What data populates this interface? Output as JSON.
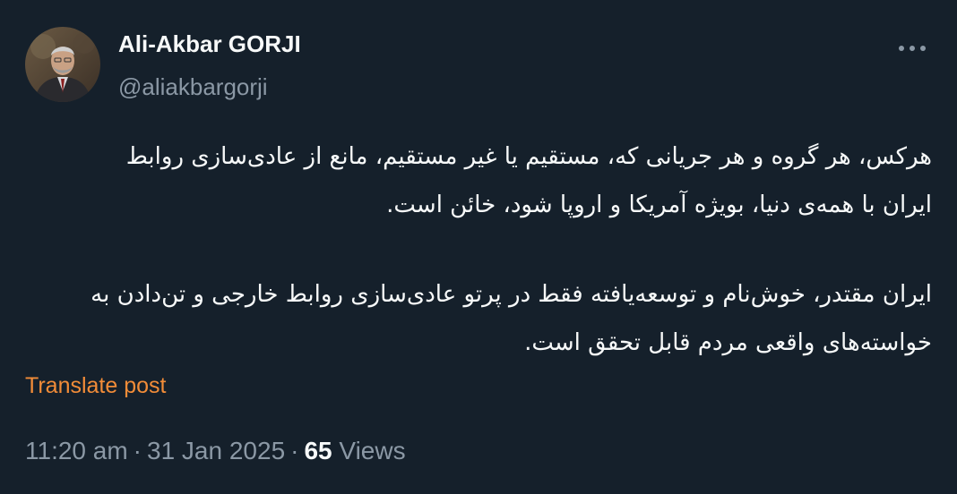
{
  "author": {
    "display_name": "Ali-Akbar GORJI",
    "handle": "@aliakbargorji"
  },
  "icons": {
    "more": "more-horizontal-icon",
    "avatar": "profile-photo"
  },
  "post": {
    "paragraph1": {
      "line1": "هرکس، هر گروه و هر جریانی که، مستقیم یا غیر مستقیم، مانع از عادی‌سازی روابط",
      "line2": "ایران با همه‌ی دنیا، بویژه آمریکا و اروپا شود، خائن است."
    },
    "paragraph2": {
      "line1": "ایران مقتدر، خوش‌نام و توسعه‌یافته فقط در پرتو عادی‌سازی روابط خارجی و تن‌دادن به",
      "line2": "خواسته‌های واقعی مردم قابل تحقق است."
    }
  },
  "translate_label": "Translate post",
  "meta": {
    "time": "11:20 am",
    "separator": "·",
    "date": "31 Jan 2025",
    "views_count": "65",
    "views_label": "Views"
  },
  "colors": {
    "background": "#15202b",
    "text": "#f7f9f9",
    "secondary": "#8b98a5",
    "accent": "#f28c38"
  }
}
